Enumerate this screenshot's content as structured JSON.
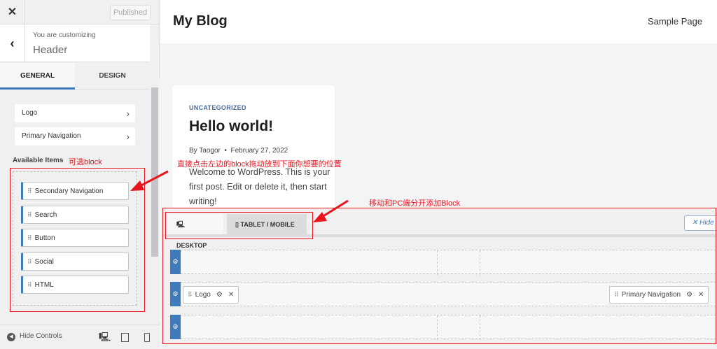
{
  "sidebar": {
    "published_label": "Published",
    "customizing_label": "You are customizing",
    "section_title": "Header",
    "tabs": [
      {
        "label": "GENERAL"
      },
      {
        "label": "DESIGN"
      }
    ],
    "nav_items": [
      {
        "label": "Logo"
      },
      {
        "label": "Primary Navigation"
      }
    ],
    "available_label": "Available Items",
    "available_items": [
      {
        "label": "Secondary Navigation"
      },
      {
        "label": "Search"
      },
      {
        "label": "Button"
      },
      {
        "label": "Social"
      },
      {
        "label": "HTML"
      }
    ],
    "hide_controls_label": "Hide Controls"
  },
  "preview": {
    "site_title": "My Blog",
    "menu_item": "Sample Page",
    "post": {
      "category": "UNCATEGORIZED",
      "title": "Hello world!",
      "author": "By Taogor",
      "date": "February 27, 2022",
      "excerpt": "Welcome to WordPress. This is your first post. Edit or delete it, then start writing!"
    }
  },
  "builder": {
    "tabs": [
      {
        "label": "DESKTOP"
      },
      {
        "label": "TABLET / MOBILE"
      }
    ],
    "hide_label": "Hide",
    "placed": {
      "logo": "Logo",
      "primary_nav": "Primary Navigation"
    }
  },
  "annotations": {
    "available": "可选block",
    "drag_hint": "直接点击左边的block拖动放到下面你想要的位置",
    "device_hint": "移动和PC端分开添加Block"
  },
  "colors": {
    "accent": "#3d7bbd",
    "annotation": "#e8141e"
  }
}
